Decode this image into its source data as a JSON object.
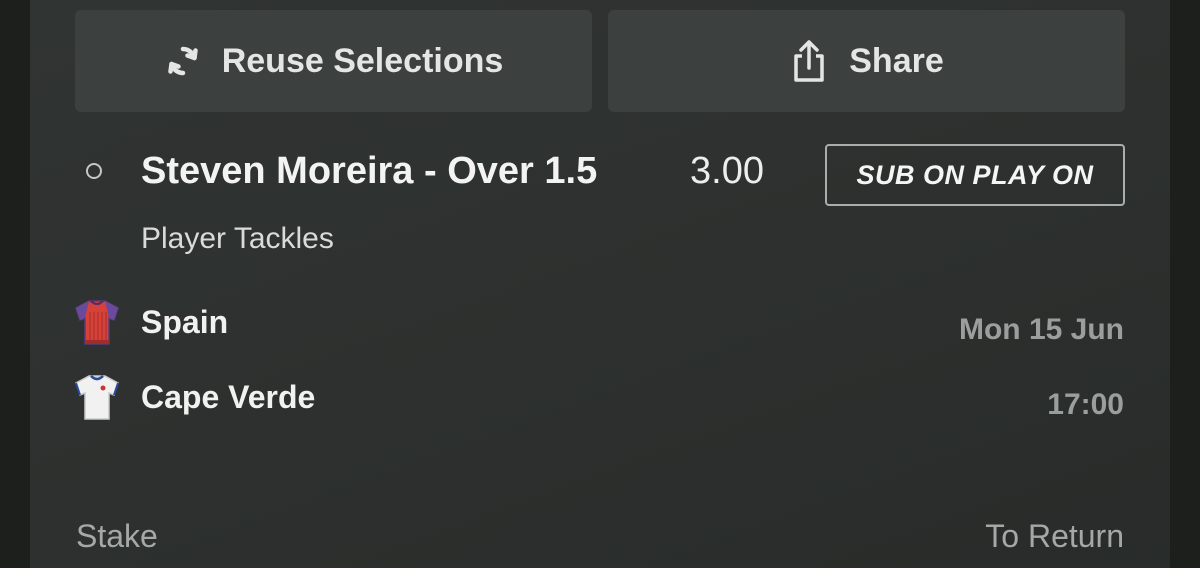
{
  "actions": {
    "reuse_label": "Reuse Selections",
    "share_label": "Share"
  },
  "selection": {
    "name": "Steven Moreira - Over 1.5",
    "odds": "3.00",
    "badge": "SUB ON PLAY ON",
    "market": "Player Tackles"
  },
  "event": {
    "home": {
      "name": "Spain",
      "kit_icon": "red-shirt-icon"
    },
    "away": {
      "name": "Cape Verde",
      "kit_icon": "white-shirt-icon"
    },
    "date": "Mon 15 Jun",
    "time": "17:00"
  },
  "footer": {
    "stake_label": "Stake",
    "return_label": "To Return"
  },
  "colors": {
    "background": "#1d1f1d",
    "card": "#2d302e",
    "button": "#3c403e",
    "text": "#f2f3f2",
    "muted": "#9a9e9c"
  }
}
